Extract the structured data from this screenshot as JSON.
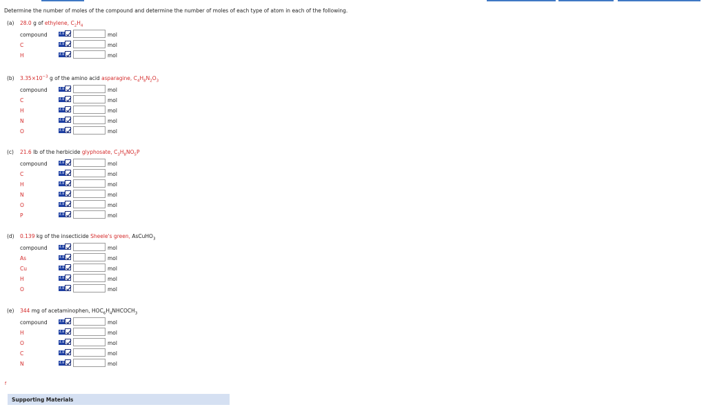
{
  "intro": "Determine the number of moles of the compound and determine the number of moles of each type of atom in each of the following.",
  "unit": "mol",
  "tool_label": "4.8",
  "parts": [
    {
      "letter": "(a)",
      "amount": "28.0",
      "unit_text": "g of",
      "name": "ethylene,",
      "formula": [
        [
          "C",
          ""
        ],
        [
          "2",
          "sub"
        ],
        [
          "H",
          ""
        ],
        [
          "4",
          "sub"
        ]
      ],
      "formula_red": true,
      "rows": [
        "compound",
        "C",
        "H"
      ]
    },
    {
      "letter": "(b)",
      "amount": "3.35×10",
      "amount_sup": "−3",
      "unit_text": "g of the amino acid",
      "name": "asparagine,",
      "formula": [
        [
          "C",
          ""
        ],
        [
          "4",
          "sub"
        ],
        [
          "H",
          ""
        ],
        [
          "8",
          "sub"
        ],
        [
          "N",
          ""
        ],
        [
          "2",
          "sub"
        ],
        [
          "O",
          ""
        ],
        [
          "3",
          "sub"
        ]
      ],
      "formula_red": true,
      "rows": [
        "compound",
        "C",
        "H",
        "N",
        "O"
      ]
    },
    {
      "letter": "(c)",
      "amount": "21.6",
      "unit_text": "lb of the herbicide",
      "name": "glyphosate,",
      "formula": [
        [
          "C",
          ""
        ],
        [
          "3",
          "sub"
        ],
        [
          "H",
          ""
        ],
        [
          "8",
          "sub"
        ],
        [
          "NO",
          ""
        ],
        [
          "5",
          "sub"
        ],
        [
          "P",
          ""
        ]
      ],
      "formula_red": true,
      "rows": [
        "compound",
        "C",
        "H",
        "N",
        "O",
        "P"
      ]
    },
    {
      "letter": "(d)",
      "amount": "0.139",
      "unit_text": "kg of the insecticide",
      "name": "Sheele's green,",
      "formula": [
        [
          "AsCuHO",
          ""
        ],
        [
          "3",
          "sub"
        ]
      ],
      "formula_red": false,
      "rows": [
        "compound",
        "As",
        "Cu",
        "H",
        "O"
      ]
    },
    {
      "letter": "(e)",
      "amount": "344",
      "unit_text": "mg of acetaminophen,",
      "name": "",
      "formula": [
        [
          "HOC",
          ""
        ],
        [
          "6",
          "sub"
        ],
        [
          "H",
          ""
        ],
        [
          "4",
          "sub"
        ],
        [
          "NHCOCH",
          ""
        ],
        [
          "3",
          "sub"
        ]
      ],
      "formula_red": false,
      "rows": [
        "compound",
        "H",
        "O",
        "C",
        "N"
      ]
    }
  ],
  "footer_mark": "f",
  "supporting": "Supporting Materials"
}
